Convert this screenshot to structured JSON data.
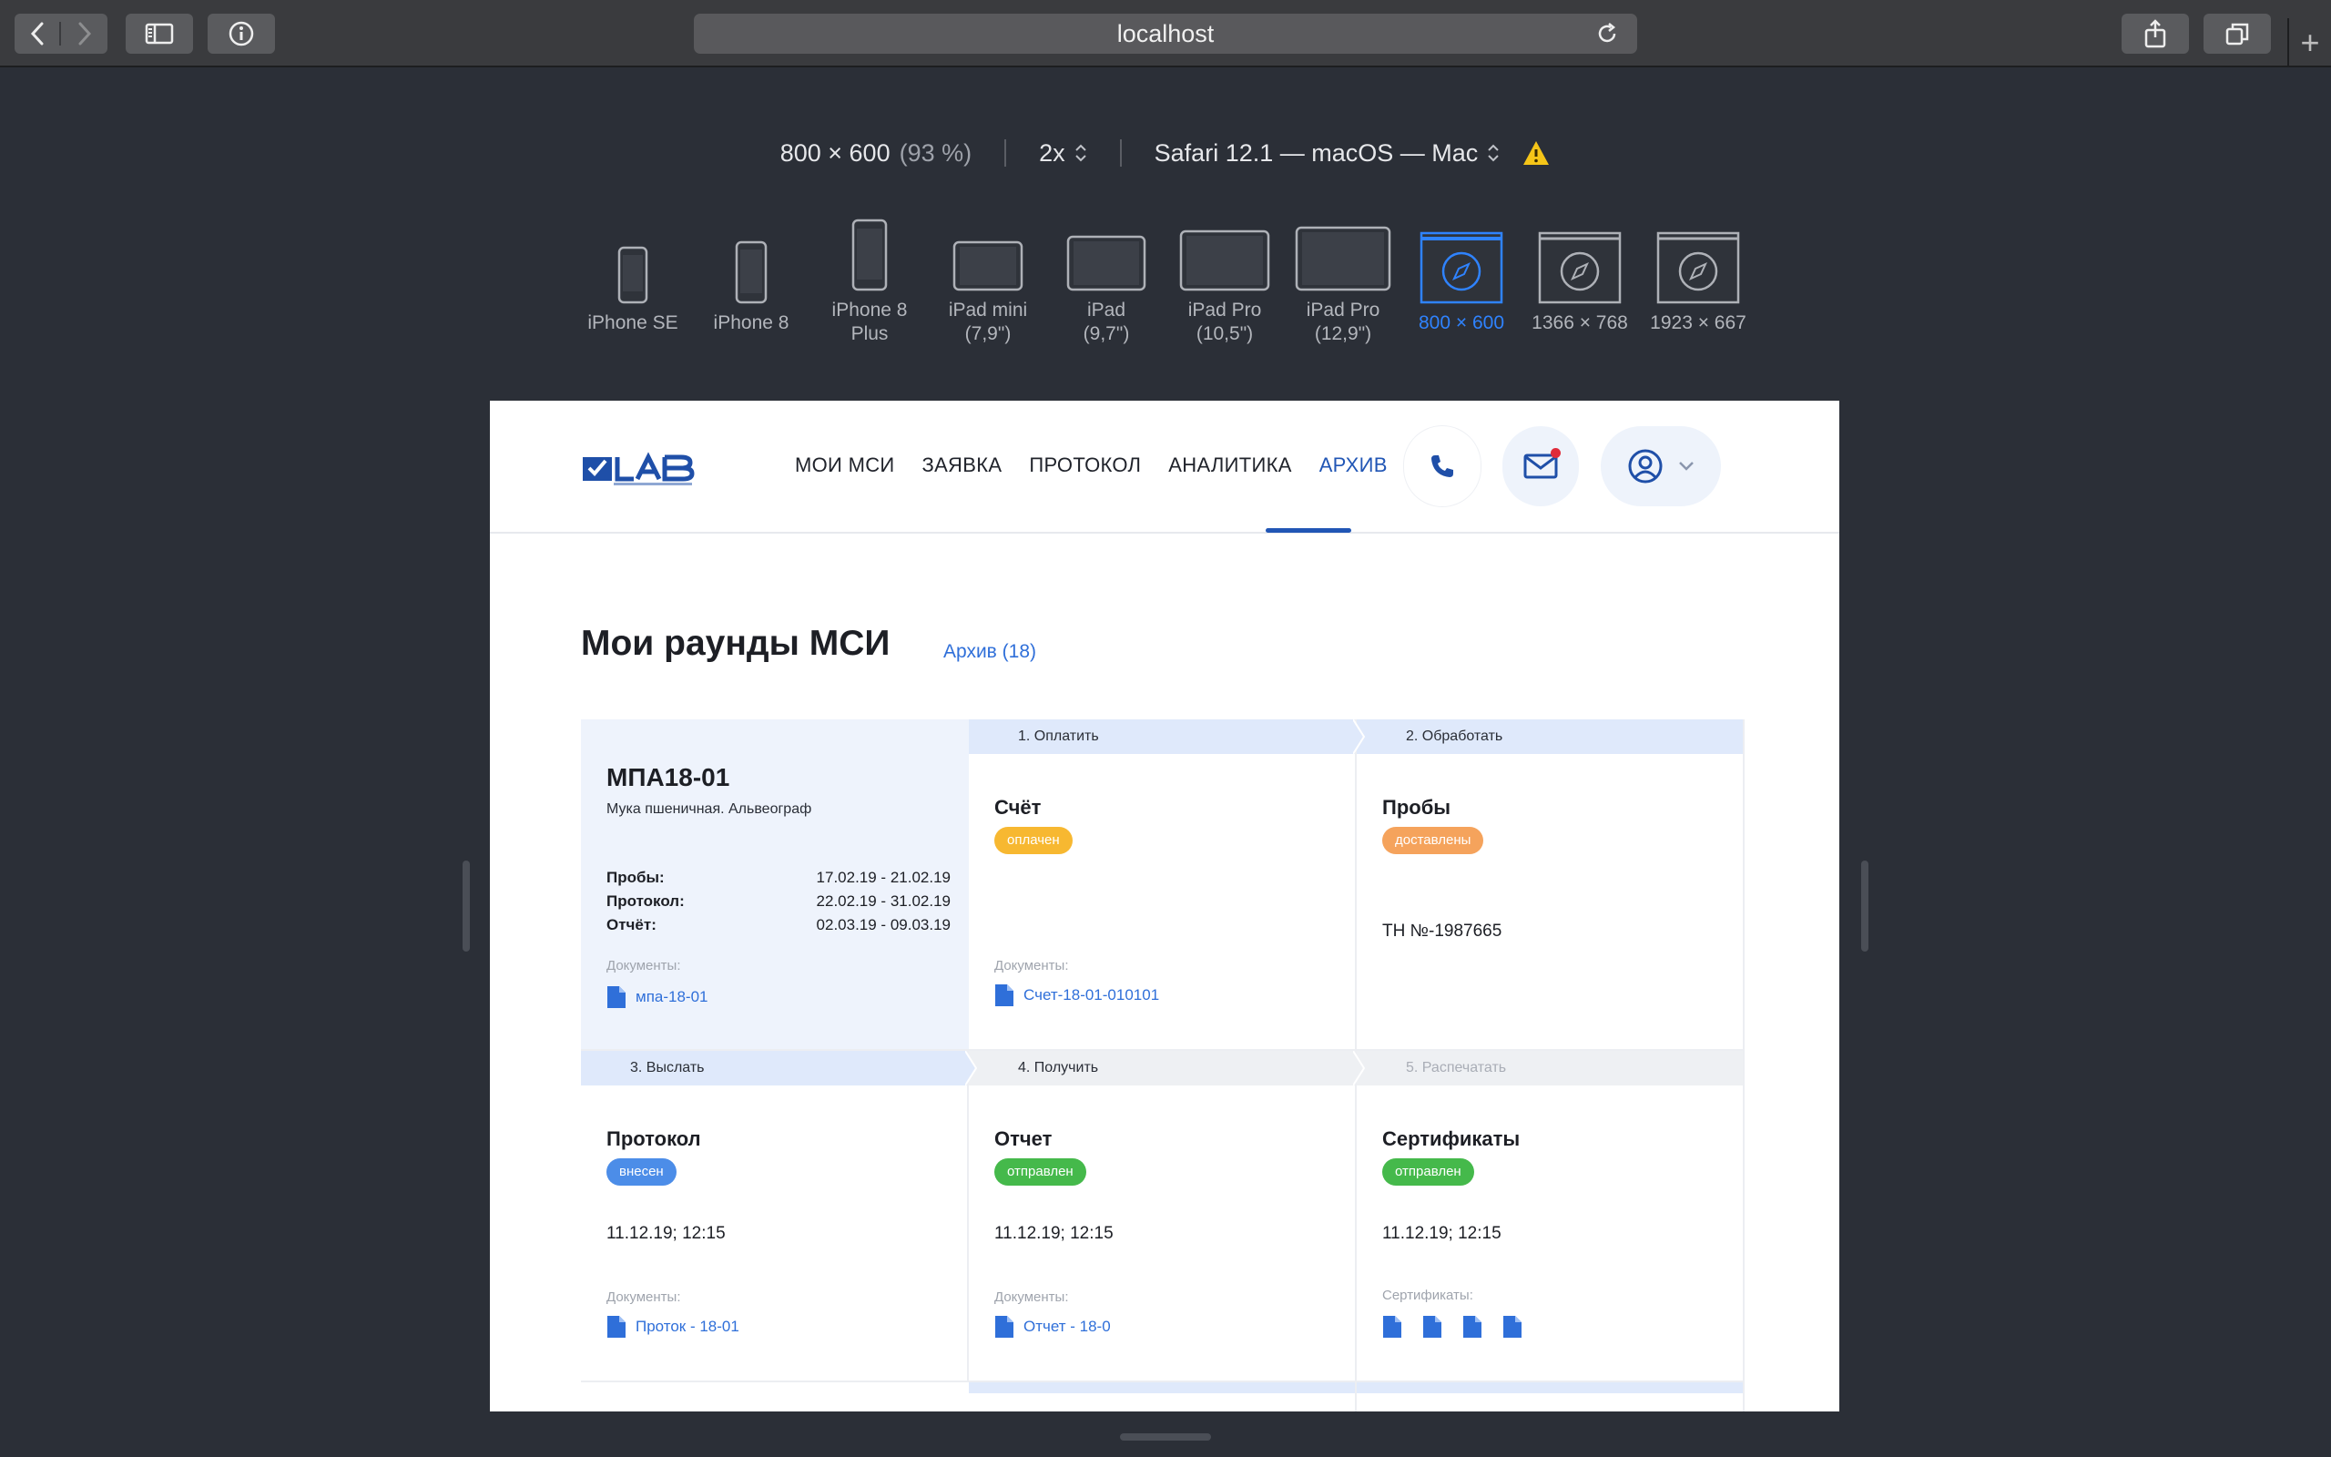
{
  "browser": {
    "address": "localhost"
  },
  "responsive": {
    "size": "800 × 600",
    "zoom": "(93 %)",
    "scale": "2x",
    "agent": "Safari 12.1 — macOS — Mac",
    "devices": [
      {
        "line1": "iPhone SE",
        "line2": ""
      },
      {
        "line1": "iPhone 8",
        "line2": ""
      },
      {
        "line1": "iPhone 8",
        "line2": "Plus"
      },
      {
        "line1": "iPad mini",
        "line2": "(7,9\")"
      },
      {
        "line1": "iPad",
        "line2": "(9,7\")"
      },
      {
        "line1": "iPad Pro",
        "line2": "(10,5\")"
      },
      {
        "line1": "iPad Pro",
        "line2": "(12,9\")"
      },
      {
        "line1": "800 × 600",
        "line2": ""
      },
      {
        "line1": "1366 × 768",
        "line2": ""
      },
      {
        "line1": "1923 × 667",
        "line2": ""
      }
    ],
    "selected_device": "800 × 600"
  },
  "site": {
    "nav": [
      "МОИ МСИ",
      "ЗАЯВКА",
      "ПРОТОКОЛ",
      "АНАЛИТИКА",
      "АРХИВ"
    ],
    "active_nav": "АРХИВ",
    "page_title": "Мои раунды МСИ",
    "archive_link": "Архив (18)",
    "round": {
      "code": "МПА18-01",
      "name": "Мука пшеничная. Альвеограф",
      "rows": [
        {
          "label": "Пробы:",
          "value": "17.02.19 - 21.02.19"
        },
        {
          "label": "Протокол:",
          "value": "22.02.19 - 31.02.19"
        },
        {
          "label": "Отчёт:",
          "value": "02.03.19 - 09.03.19"
        }
      ],
      "docs_label": "Документы:",
      "doc": "мпа-18-01"
    },
    "steps": {
      "s1": "1. Оплатить",
      "s2": "2. Обработать",
      "s3": "3. Выслать",
      "s4": "4. Получить",
      "s5": "5. Распечатать"
    },
    "cards": {
      "invoice": {
        "title": "Счёт",
        "badge": "оплачен",
        "docs_label": "Документы:",
        "doc": "Счет-18-01-010101"
      },
      "samples": {
        "title": "Пробы",
        "badge": "доставлены",
        "meta": "ТН №-1987665"
      },
      "protocol": {
        "title": "Протокол",
        "badge": "внесен",
        "meta": "11.12.19; 12:15",
        "docs_label": "Документы:",
        "doc": "Проток - 18-01"
      },
      "report": {
        "title": "Отчет",
        "badge": "отправлен",
        "meta": "11.12.19; 12:15",
        "docs_label": "Документы:",
        "doc": "Отчет - 18-0"
      },
      "certs": {
        "title": "Сертификаты",
        "badge": "отправлен",
        "meta": "11.12.19; 12:15",
        "docs_label": "Сертификаты:"
      }
    }
  },
  "colors": {
    "accent": "#2156b5",
    "link": "#2f6fd9",
    "badge_yellow": "#f7b831",
    "badge_orange": "#f5a35c",
    "badge_blue": "#4c8de8",
    "badge_green": "#45b94b",
    "selected_device": "#2f83ff"
  }
}
